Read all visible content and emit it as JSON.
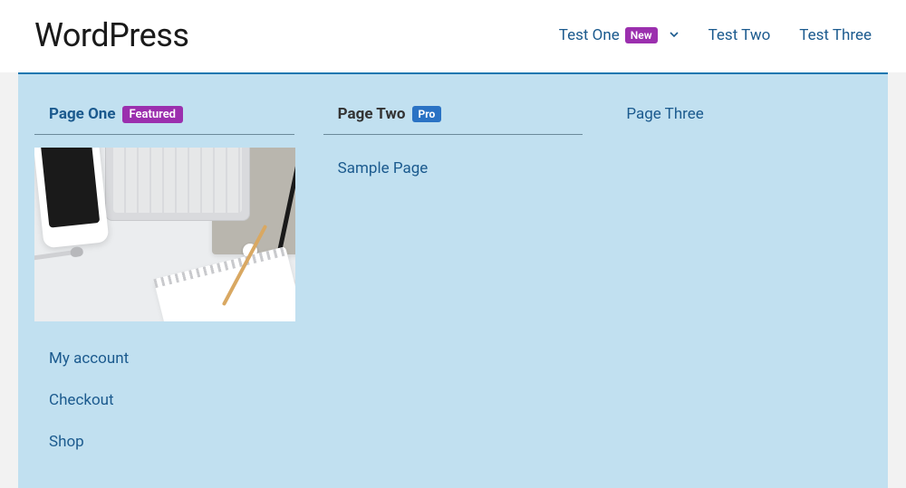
{
  "header": {
    "logo": "WordPress",
    "nav": [
      {
        "label": "Test One",
        "badge": "New",
        "has_dropdown": true
      },
      {
        "label": "Test Two"
      },
      {
        "label": "Test Three"
      }
    ]
  },
  "mega": {
    "columns": [
      {
        "title": "Page One",
        "badge": {
          "text": "Featured",
          "variant": "featured"
        },
        "style": "link",
        "has_image": true,
        "links": [
          "My account",
          "Checkout",
          "Shop"
        ]
      },
      {
        "title": "Page Two",
        "badge": {
          "text": "Pro",
          "variant": "pro"
        },
        "style": "heading",
        "underline": true,
        "links": [
          "Sample Page"
        ]
      },
      {
        "title": "Page Three",
        "style": "link-plain"
      }
    ]
  }
}
